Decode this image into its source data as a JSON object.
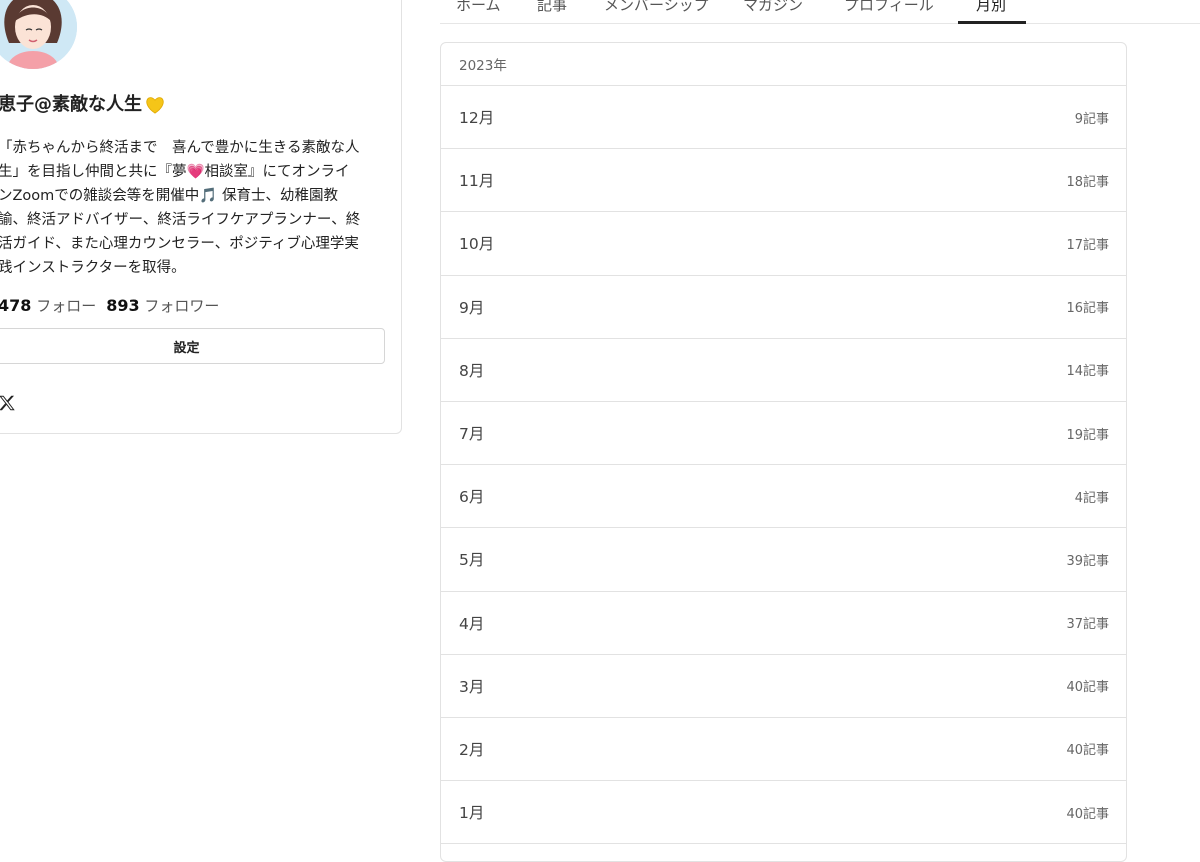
{
  "profile": {
    "name": "恵子@素敵な人生",
    "bio": "「赤ちゃんから終活まで　喜んで豊かに生きる素敵な人\n生」を目指し仲間と共に『夢💗相談室』にてオンライ\nンZoomでの雑談会等を開催中🎵 保育士、幼稚園教\n諭、終活アドバイザー、終活ライフケアプランナー、終\n活ガイド、また心理カウンセラー、ポジティブ心理学実\n践インストラクターを取得。",
    "following_count": "478",
    "following_label": "フォロー",
    "followers_count": "893",
    "followers_label": "フォロワー",
    "settings_label": "設定",
    "more_icon": "more-icon",
    "social_icon": "x-icon",
    "heart_color": "#f5c518"
  },
  "tabs": [
    {
      "label": "ホーム"
    },
    {
      "label": "記事"
    },
    {
      "label": "メンバーシップ"
    },
    {
      "label": "マガジン"
    },
    {
      "label": "プロフィール"
    },
    {
      "label": "月別",
      "active": true
    }
  ],
  "archive": {
    "year": "2023年",
    "months": [
      {
        "month": "12月",
        "count": "9記事"
      },
      {
        "month": "11月",
        "count": "18記事"
      },
      {
        "month": "10月",
        "count": "17記事"
      },
      {
        "month": "9月",
        "count": "16記事"
      },
      {
        "month": "8月",
        "count": "14記事"
      },
      {
        "month": "7月",
        "count": "19記事"
      },
      {
        "month": "6月",
        "count": "4記事"
      },
      {
        "month": "5月",
        "count": "39記事"
      },
      {
        "month": "4月",
        "count": "37記事"
      },
      {
        "month": "3月",
        "count": "40記事"
      },
      {
        "month": "2月",
        "count": "40記事"
      },
      {
        "month": "1月",
        "count": "40記事"
      }
    ]
  }
}
